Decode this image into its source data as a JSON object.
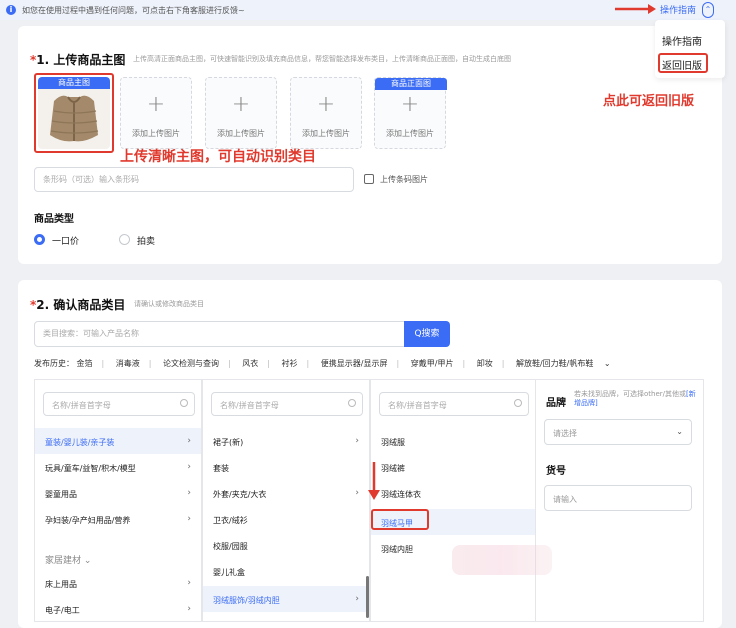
{
  "notice": {
    "text": "如您在使用过程中遇到任何问题，可点击右下角客服进行反馈~",
    "guide_link": "操作指南",
    "collapse_glyph": "⌃"
  },
  "dropdown": {
    "item1": "操作指南",
    "item2": "返回旧版",
    "annotation": "点此可返回旧版"
  },
  "section1": {
    "star": "*",
    "title": "1. 上传商品主图",
    "desc": "上传高清正面商品主图，可快速智能识别及填充商品信息，帮您智能选择发布类目，上传清晰商品正面图，自动生成白底图",
    "main_badge": "商品主图",
    "upload_label": "添加上传图片",
    "front_badge": "商品正面图",
    "annotation": "上传清晰主图，可自动识别类目",
    "barcode_placeholder": "条形码（可选）输入条形码",
    "barcode_upload": "上传条码图片",
    "type_label": "商品类型",
    "type_options": [
      "一口价",
      "拍卖"
    ]
  },
  "section2": {
    "star": "*",
    "title": "2. 确认商品类目",
    "desc": "请确认或修改商品类目",
    "search_placeholder": "类目搜索：可输入产品名称",
    "search_button": "Q搜索",
    "history_label": "发布历史：",
    "history_items": [
      "金箔",
      "消毒液",
      "论文检测与查询",
      "风衣",
      "衬衫",
      "便携显示器/显示屏",
      "穿戴甲/甲片",
      "卸妆",
      "解放鞋/回力鞋/帆布鞋"
    ],
    "history_more": "⌄",
    "col_search_placeholder": "名称/拼音首字母",
    "col1": [
      "童装/婴儿装/亲子装",
      "玩具/童车/益智/积木/模型",
      "婴童用品",
      "孕妇装/孕产妇用品/营养"
    ],
    "col1_group": "家居建材",
    "col1_group_items": [
      "床上用品",
      "电子/电工"
    ],
    "col2": [
      "裙子(新)",
      "套装",
      "外套/夹克/大衣",
      "卫衣/绒衫",
      "校服/园服",
      "婴儿礼盒",
      "羽绒服饰/羽绒内胆"
    ],
    "col3": [
      "羽绒服",
      "羽绒裤",
      "羽绒连体衣",
      "羽绒马甲",
      "羽绒内胆"
    ],
    "brand_label": "品牌",
    "brand_hint": "若未找到品牌，可选择other/其他或",
    "brand_link": "[新增品牌]",
    "brand_select": "请选择",
    "sku_label": "货号",
    "sku_placeholder": "请输入"
  },
  "colors": {
    "accent": "#3b6cf5",
    "annotation_red": "#e03a2e"
  }
}
